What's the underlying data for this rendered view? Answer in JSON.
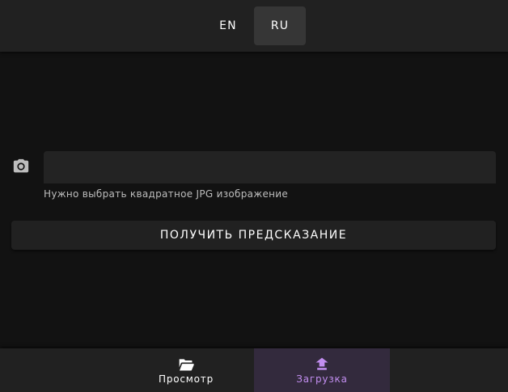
{
  "language_bar": {
    "options": [
      {
        "label": "EN",
        "active": false
      },
      {
        "label": "RU",
        "active": true
      }
    ]
  },
  "upload_form": {
    "icon": "camera-icon",
    "file_field_value": "",
    "hint": "Нужно выбрать квадратное JPG изображение",
    "predict_button_label": "ПОЛУЧИТЬ ПРЕДСКАЗАНИЕ"
  },
  "bottom_nav": {
    "items": [
      {
        "label": "Просмотр",
        "icon": "folder-open-icon",
        "active": false
      },
      {
        "label": "Загрузка",
        "icon": "upload-icon",
        "active": true
      }
    ]
  },
  "colors": {
    "background": "#121212",
    "surface": "#212121",
    "active_lang": "#363636",
    "active_nav_bg": "#332a3d",
    "accent": "#c28ef0"
  }
}
